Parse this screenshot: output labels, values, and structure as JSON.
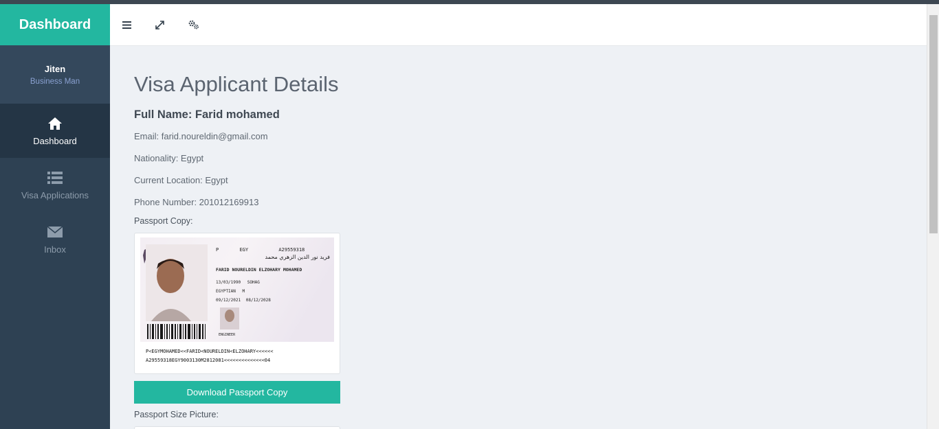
{
  "sidebar": {
    "brand": "Dashboard",
    "user": {
      "name": "Jiten",
      "role": "Business Man"
    },
    "items": [
      {
        "label": "Dashboard",
        "icon": "home-icon",
        "active": true
      },
      {
        "label": "Visa Applications",
        "icon": "list-icon",
        "active": false
      },
      {
        "label": "Inbox",
        "icon": "envelope-icon",
        "active": false
      }
    ]
  },
  "header": {
    "buttons": [
      "menu-icon",
      "expand-icon",
      "settings-icon"
    ]
  },
  "main": {
    "title": "Visa Applicant Details",
    "full_name": "Full Name: Farid mohamed",
    "email": "Email: farid.noureldin@gmail.com",
    "nationality": "Nationality: Egypt",
    "location": "Current Location: Egypt",
    "phone": "Phone Number: 201012169913",
    "passport_label": "Passport Copy:",
    "download_label": "Download Passport Copy",
    "picture_label": "Passport Size Picture:"
  },
  "passport": {
    "type_code": "P",
    "country": "EGY",
    "number": "A29559318",
    "arabic_name": "فريد نور الدين الزهري محمد",
    "latin_name": "FARID NOURELDIN ELZOHARY MOHAMED",
    "dob": "13/03/1990",
    "place": "SOHAG",
    "nationality": "EGYPTIAN",
    "sex": "M",
    "issue": "09/12/2021",
    "expiry": "08/12/2028",
    "profession": "ENGINEER",
    "mrz1": "P<EGYMOHAMED<<FARID<NOURELDIN<ELZOHARY<<<<<<",
    "mrz2": "A29559318EGY9003130M2812081<<<<<<<<<<<<<<04"
  },
  "colors": {
    "accent": "#23b7a0",
    "sidebar": "#2e4153",
    "sidebar_active": "#243545",
    "background": "#eef1f5"
  }
}
